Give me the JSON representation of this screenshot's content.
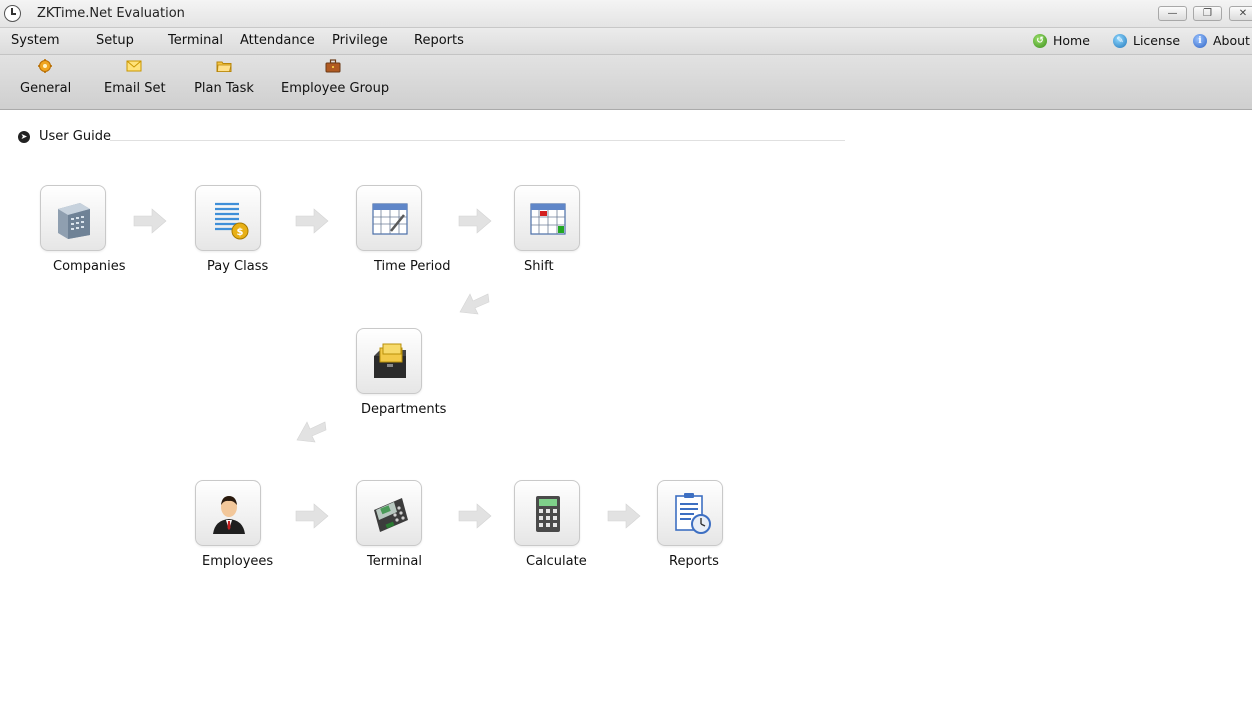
{
  "window": {
    "title": "ZKTime.Net Evaluation"
  },
  "menu": {
    "items": [
      "System",
      "Setup",
      "Terminal",
      "Attendance",
      "Privilege",
      "Reports"
    ],
    "right": {
      "home": "Home",
      "license": "License",
      "about": "About"
    }
  },
  "toolbar": {
    "general": "General",
    "email_set": "Email Set",
    "plan_task": "Plan Task",
    "employee_group": "Employee Group"
  },
  "guide": {
    "title": "User Guide",
    "nodes": {
      "companies": "Companies",
      "pay_class": "Pay Class",
      "time_period": "Time Period",
      "shift": "Shift",
      "departments": "Departments",
      "employees": "Employees",
      "terminal": "Terminal",
      "calculate": "Calculate",
      "reports": "Reports"
    }
  },
  "colors": {
    "toolbar_bg": "#d8d8d8",
    "menubar_bg": "#e4e4e4",
    "arrow": "#e2e2e2"
  }
}
